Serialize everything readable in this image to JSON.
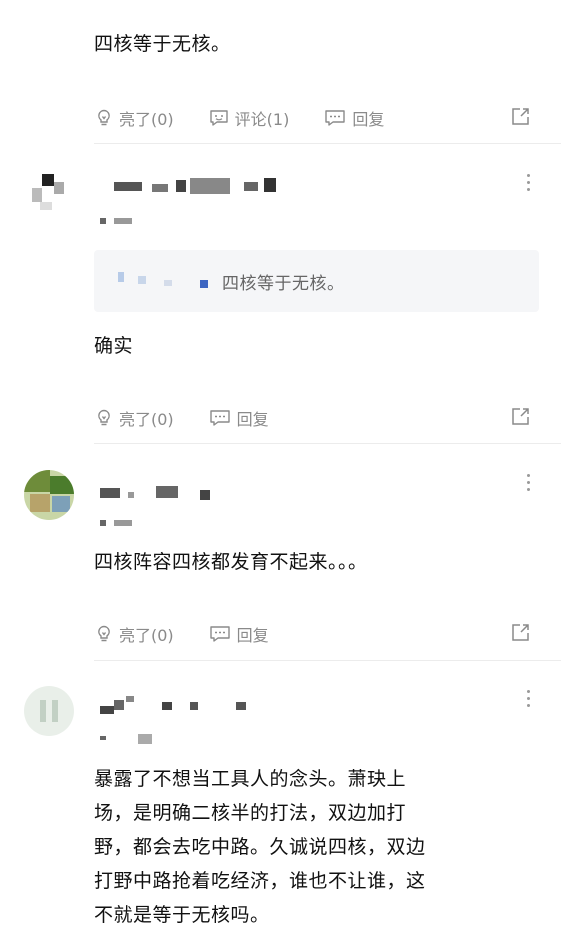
{
  "post_tail": {
    "text": "四核等于无核。",
    "actions": {
      "like": "亮了(0)",
      "comment": "评论(1)",
      "reply": "回复"
    }
  },
  "comments": [
    {
      "quote": "四核等于无核。",
      "text": "确实",
      "actions": {
        "like": "亮了(0)",
        "reply": "回复"
      }
    },
    {
      "text": "四核阵容四核都发育不起来。。。",
      "actions": {
        "like": "亮了(0)",
        "reply": "回复"
      }
    },
    {
      "lines": [
        "暴露了不想当工具人的念头。萧玦上",
        "场，是明确二核半的打法，双边加打",
        "野，都会去吃中路。久诚说四核，双边",
        "打野中路抢着吃经济，谁也不让谁，这",
        "不就是等于无核吗。"
      ]
    }
  ],
  "icons": {
    "like": "lightbulb-icon",
    "comment": "comment-bubble-icon",
    "reply": "reply-bubble-icon",
    "share": "share-icon",
    "more": "more-vertical-icon"
  },
  "colors": {
    "action_gray": "#8a8a8a",
    "quote_bg": "#f5f6f8",
    "divider": "#ececec"
  }
}
